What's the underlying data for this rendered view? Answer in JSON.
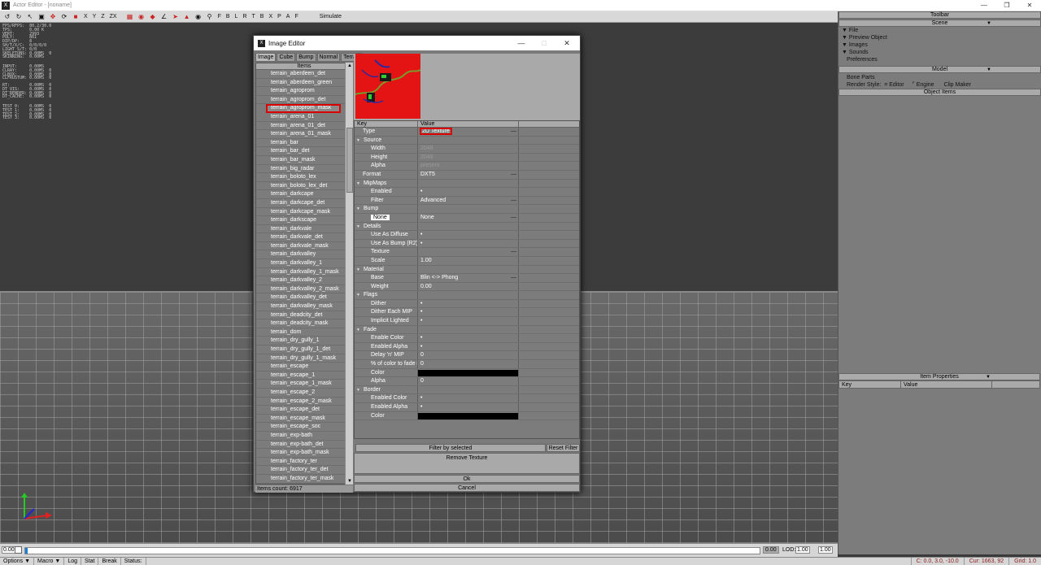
{
  "app": {
    "title": "Actor Editor - [noname]"
  },
  "toolbar": {
    "icons": [
      "cursor-icon",
      "move-icon",
      "rotate-icon",
      "scale-icon",
      "snap-icon",
      "light-icon",
      "x-axis",
      "y-axis",
      "z-axis",
      "zx-plane"
    ],
    "axes": [
      "X",
      "Y",
      "Z",
      "ZX"
    ],
    "views": [
      "F",
      "B",
      "L",
      "R",
      "T",
      "B",
      "X"
    ],
    "pa": [
      "P",
      "A",
      "F"
    ],
    "simulate": "Simulate"
  },
  "stats": {
    "block1": "FPS/RFPS:  80.2/30.0\nTPS:       0.00 K\nVERT:      2993\nPOLY:      861\nDIP/DP:    8\nSH/T/X/C:  0/0/0/0\nLIGHT S/T: 0/0\nSKELETONS: 0.00MS  0\nSKINNING:  0.00MS",
    "block2": "INPUT:     0.00MS\nCLRAY:     0.00MS  0\nCLBOX:     0.00MS  0\nCLFRUSTUM: 0.00MS  0",
    "block3": "RT:        0.00MS  0\nDT_VIS:    0.00MS  0\nDT_RENDER: 0.00MS  0\nDT_CACHE:  0.00MS  0",
    "block4": "TEST 0:    0.00MS  0\nTEST 1:    0.00MS  0\nTEST 2:    0.00MS  0\nTEST 3:    0.00MS  0"
  },
  "right_panel": {
    "toolbar_title": "Toolbar",
    "scene_title": "Scene",
    "scene_items": [
      "File",
      "Preview Object",
      "Images",
      "Sounds"
    ],
    "preferences": "Preferences",
    "model_title": "Model",
    "bone_parts": "Bone Parts",
    "render_style": "Render Style:",
    "editor": "Editor",
    "engine": "Engine",
    "clip_maker": "Clip Maker",
    "object_items": "Object Items",
    "item_properties": "Item Properties",
    "key_col": "Key",
    "value_col": "Value"
  },
  "dialog": {
    "title": "Image Editor",
    "tabs": [
      "Image",
      "Cube",
      "Bump",
      "Normal",
      "Terrain"
    ],
    "list_header": "Items",
    "items": [
      "terrain_aberdeen_det",
      "terrain_aberdeen_green",
      "terrain_agroprom",
      "terrain_agroprom_det",
      "terrain_agroprom_mask",
      "terrain_arena_01",
      "terrain_arena_01_det",
      "terrain_arena_01_mask",
      "terrain_bar",
      "terrain_bar_det",
      "terrain_bar_mask",
      "terrain_big_radar",
      "terrain_boloto_lex",
      "terrain_boloto_lex_det",
      "terrain_darkcape",
      "terrain_darkcape_det",
      "terrain_darkcape_mask",
      "terrain_darkscape",
      "terrain_darkvale",
      "terrain_darkvale_det",
      "terrain_darkvale_mask",
      "terrain_darkvalley",
      "terrain_darkvalley_1",
      "terrain_darkvalley_1_mask",
      "terrain_darkvalley_2",
      "terrain_darkvalley_2_mask",
      "terrain_darkvalley_det",
      "terrain_darkvalley_mask",
      "terrain_deadcity_det",
      "terrain_deadcity_mask",
      "terrain_dom",
      "terrain_dry_gully_1",
      "terrain_dry_gully_1_det",
      "terrain_dry_gully_1_mask",
      "terrain_escape",
      "terrain_escape_1",
      "terrain_escape_1_mask",
      "terrain_escape_2",
      "terrain_escape_2_mask",
      "terrain_escape_det",
      "terrain_escape_mask",
      "terrain_escape_soc",
      "terrain_exp-bath",
      "terrain_exp-bath_det",
      "terrain_exp-bath_mask",
      "terrain_factory_ter",
      "terrain_factory_ter_det",
      "terrain_factory_ter_mask"
    ],
    "selected_index": 4,
    "items_count": "Items count: 6917",
    "props_key": "Key",
    "props_value": "Value",
    "props": [
      {
        "k": "Type",
        "lvl": 1,
        "v": "2D Texture",
        "dash": true,
        "hl": true
      },
      {
        "k": "Source",
        "lvl": 0,
        "grp": true
      },
      {
        "k": "Width",
        "lvl": 2,
        "v": "2048",
        "dim": true
      },
      {
        "k": "Height",
        "lvl": 2,
        "v": "2048",
        "dim": true
      },
      {
        "k": "Alpha",
        "lvl": 2,
        "v": "present",
        "dim": true
      },
      {
        "k": "Format",
        "lvl": 1,
        "v": "DXT5",
        "dash": true
      },
      {
        "k": "MipMaps",
        "lvl": 0,
        "grp": true
      },
      {
        "k": "Enabled",
        "lvl": 2,
        "v": "•"
      },
      {
        "k": "Filter",
        "lvl": 2,
        "v": "Advanced",
        "dash": true
      },
      {
        "k": "Bump",
        "lvl": 0,
        "grp": true
      },
      {
        "k": "None",
        "lvl": 2,
        "v": "None",
        "dash": true,
        "boxkey": true
      },
      {
        "k": "Details",
        "lvl": 0,
        "grp": true
      },
      {
        "k": "Use As Diffuse",
        "lvl": 2,
        "v": "•"
      },
      {
        "k": "Use As Bump (R2)",
        "lvl": 2,
        "v": "•"
      },
      {
        "k": "Texture",
        "lvl": 2,
        "v": "",
        "dash": true
      },
      {
        "k": "Scale",
        "lvl": 2,
        "v": "1.00"
      },
      {
        "k": "Material",
        "lvl": 0,
        "grp": true
      },
      {
        "k": "Base",
        "lvl": 2,
        "v": "Blin <-> Phong",
        "dash": true
      },
      {
        "k": "Weight",
        "lvl": 2,
        "v": "0.00"
      },
      {
        "k": "Flags",
        "lvl": 0,
        "grp": true
      },
      {
        "k": "Dither",
        "lvl": 2,
        "v": "•"
      },
      {
        "k": "Dither Each MIP",
        "lvl": 2,
        "v": "•"
      },
      {
        "k": "Implicit Lighted",
        "lvl": 2,
        "v": "•"
      },
      {
        "k": "Fade",
        "lvl": 0,
        "grp": true
      },
      {
        "k": "Enable Color",
        "lvl": 2,
        "v": "•"
      },
      {
        "k": "Enabled Alpha",
        "lvl": 2,
        "v": "•"
      },
      {
        "k": "Delay 'n' MIP",
        "lvl": 2,
        "v": "0"
      },
      {
        "k": "% of color to fade in",
        "lvl": 2,
        "v": "0"
      },
      {
        "k": "Color",
        "lvl": 2,
        "v": "",
        "black": true
      },
      {
        "k": "Alpha",
        "lvl": 2,
        "v": "0"
      },
      {
        "k": "Border",
        "lvl": 0,
        "grp": true
      },
      {
        "k": "Enabled Color",
        "lvl": 2,
        "v": "•"
      },
      {
        "k": "Enabled Alpha",
        "lvl": 2,
        "v": "•"
      },
      {
        "k": "Color",
        "lvl": 2,
        "v": "",
        "black": true
      }
    ],
    "filter_by_selected": "Filter by selected",
    "reset_filter": "Reset Filter",
    "remove_texture": "Remove Texture",
    "ok": "Ok",
    "cancel": "Cancel"
  },
  "status": {
    "left_value": "0.00",
    "right_value": "0.00",
    "lod_label": "LOD:",
    "lod_value": "1.00",
    "lod_value2": "1.00",
    "progress": 0.003
  },
  "bottom": {
    "buttons": [
      "Options",
      "Macro",
      "Log",
      "Stat",
      "Break",
      "Status:"
    ],
    "coords": "C: 0.0, 3.0, -10.0",
    "cur": "Cur: 1663, 92",
    "grid": "Grid: 1.0"
  },
  "colors": {
    "accent": "#1a7fd6",
    "highlight": "#dd0000",
    "thumb": "#e41414"
  }
}
